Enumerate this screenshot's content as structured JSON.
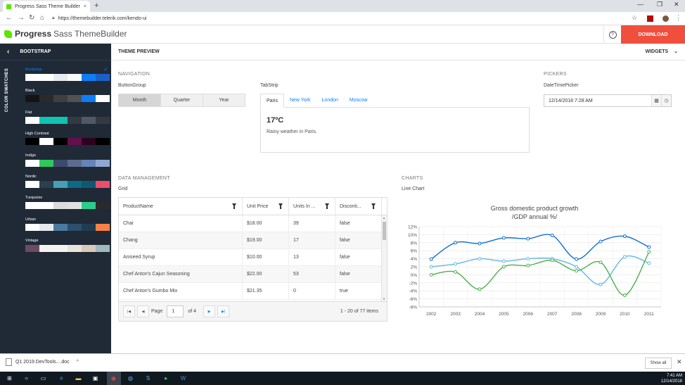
{
  "browser": {
    "tab_title": "Progress Sass Theme Builder",
    "tab_close": "×",
    "new_tab": "+",
    "url": "https://themebuilder.telerik.com/kendo-ui"
  },
  "header": {
    "logo_brand": "Progress",
    "logo_product": "Sass ThemeBuilder",
    "help_icon": "?",
    "download_label": "DOWNLOAD"
  },
  "sidebar": {
    "title": "BOOTSTRAP",
    "vertical_label": "COLOR SWATCHES",
    "swatches": [
      {
        "name": "Bootstrap",
        "colors": [
          "#ffffff",
          "#ffffff",
          "#e9ecef",
          "#f8f9fa",
          "#0d7ef6",
          "#1b60c8"
        ]
      },
      {
        "name": "Black",
        "colors": [
          "#141414",
          "#2a2a2a",
          "#3f3f3f",
          "#525252",
          "#0d7ef6",
          "#ffffff"
        ]
      },
      {
        "name": "Flat",
        "colors": [
          "#ffffff",
          "#10c4b2",
          "#10c4b2",
          "#363940",
          "#525964",
          "#363940"
        ]
      },
      {
        "name": "High Contrast",
        "colors": [
          "#000000",
          "#ffffff",
          "#000000",
          "#660e4d",
          "#2b0320",
          "#000000"
        ]
      },
      {
        "name": "Indigo",
        "colors": [
          "#ffffff",
          "#2ec95c",
          "#3c4a6d",
          "#5d6c8e",
          "#6684b7",
          "#8fa8d2"
        ]
      },
      {
        "name": "Nordic",
        "colors": [
          "#ffffff",
          "#2b3f4e",
          "#489fb5",
          "#0c6a87",
          "#0f5874",
          "#ec4e6d"
        ]
      },
      {
        "name": "Turquoise",
        "colors": [
          "#ffffff",
          "#ffffff",
          "#dcdcdc",
          "#e1e1e1",
          "#2bcd8c",
          "#2a2a2a"
        ]
      },
      {
        "name": "Urban",
        "colors": [
          "#ffffff",
          "#e7ebef",
          "#4a7aa0",
          "#2c4f6b",
          "#203c52",
          "#f88145"
        ]
      },
      {
        "name": "Vintage",
        "colors": [
          "#6e4a63",
          "#f5f3ef",
          "#f5f3ef",
          "#e9e4da",
          "#d9cbb8",
          "#9fb9bc"
        ]
      }
    ]
  },
  "main": {
    "title": "THEME PREVIEW",
    "widgets_label": "WIDGETS",
    "navigation": {
      "section": "NAVIGATION",
      "buttongroup_label": "ButtonGroup",
      "buttons": [
        "Month",
        "Quarter",
        "Year"
      ],
      "tabstrip_label": "TabStrip",
      "tabs": [
        "Paris",
        "New York",
        "London",
        "Moscow"
      ],
      "temp": "17ºC",
      "weather": "Rainy weather in Paris."
    },
    "pickers": {
      "section": "PICKERS",
      "label": "DateTimePicker",
      "value": "12/14/2018 7:28 AM"
    },
    "data": {
      "section": "DATA MANAGEMENT",
      "label": "Grid",
      "columns": [
        "ProductName",
        "Unit Price",
        "Units In ...",
        "Disconti..."
      ],
      "rows": [
        [
          "Chai",
          "$18.00",
          "39",
          "false"
        ],
        [
          "Chang",
          "$19.00",
          "17",
          "false"
        ],
        [
          "Aniseed Syrup",
          "$10.00",
          "13",
          "false"
        ],
        [
          "Chef Anton's Cajun Seasoning",
          "$22.00",
          "53",
          "false"
        ],
        [
          "Chef Anton's Gumbo Mix",
          "$21.35",
          "0",
          "true"
        ]
      ],
      "pager": {
        "page_label": "Page",
        "page": "1",
        "of_label": "of 4",
        "info": "1 - 20 of 77 items"
      }
    },
    "charts": {
      "section": "CHARTS",
      "label": "Line Chart"
    }
  },
  "chart_data": {
    "type": "line",
    "title_line1": "Gross domestic product growth",
    "title_line2": "/GDP annual %/",
    "categories": [
      "2002",
      "2003",
      "2004",
      "2005",
      "2006",
      "2007",
      "2008",
      "2009",
      "2010",
      "2011"
    ],
    "ylim": [
      -8,
      12
    ],
    "yticks": [
      "12%",
      "10%",
      "8%",
      "6%",
      "4%",
      "2%",
      "0%",
      "-2%",
      "-4%",
      "-6%",
      "-8%"
    ],
    "series": [
      {
        "color": "#0d6fd6",
        "values": [
          3.9,
          8.0,
          7.8,
          9.2,
          9.0,
          9.8,
          3.9,
          8.3,
          9.6,
          6.9
        ]
      },
      {
        "color": "#5fb8e8",
        "values": [
          2.0,
          2.7,
          4.0,
          3.4,
          4.0,
          4.0,
          2.0,
          -2.4,
          4.5,
          2.9
        ]
      },
      {
        "color": "#4cb04c",
        "values": [
          0.0,
          0.7,
          -3.6,
          2.0,
          2.3,
          3.6,
          1.0,
          3.1,
          -5.1,
          5.7
        ]
      }
    ]
  },
  "downloads": {
    "file": "Q1 2019 DevTools....doc",
    "show_all": "Show all"
  },
  "taskbar": {
    "time": "7:41 AM",
    "date": "12/14/2018"
  }
}
